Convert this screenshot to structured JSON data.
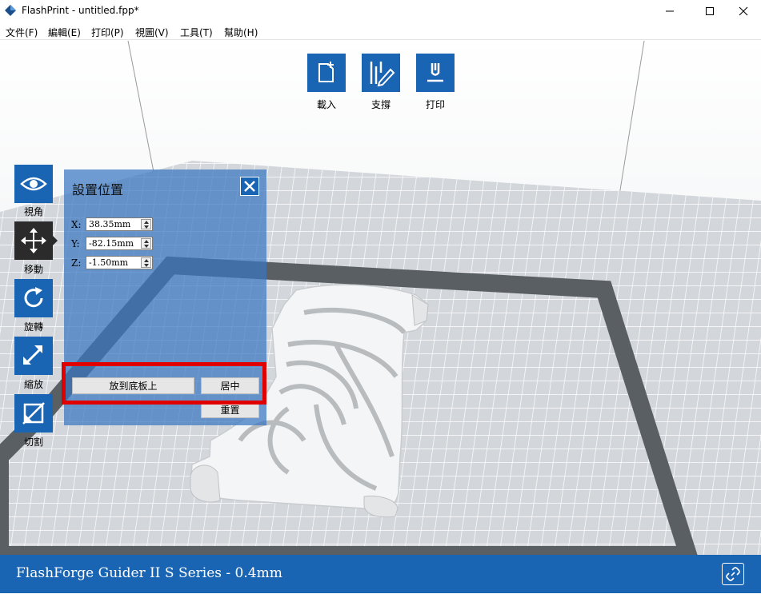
{
  "window": {
    "title": "FlashPrint - untitled.fpp*",
    "logo_icon": "flashprint-logo-icon",
    "controls": [
      "minimize-icon",
      "maximize-icon",
      "close-icon"
    ]
  },
  "menu": {
    "items": [
      "文件(F)",
      "編輯(E)",
      "打印(P)",
      "視圖(V)",
      "工具(T)",
      "幫助(H)"
    ]
  },
  "toolbar": {
    "buttons": [
      {
        "label": "載入",
        "icon": "load-file-icon"
      },
      {
        "label": "支撐",
        "icon": "support-icon"
      },
      {
        "label": "打印",
        "icon": "print-icon"
      }
    ]
  },
  "sidebar": {
    "items": [
      {
        "label": "視角",
        "icon": "eye-icon",
        "active": false
      },
      {
        "label": "移動",
        "icon": "move-icon",
        "active": true
      },
      {
        "label": "旋轉",
        "icon": "rotate-icon",
        "active": false
      },
      {
        "label": "縮放",
        "icon": "scale-icon",
        "active": false
      },
      {
        "label": "切割",
        "icon": "cut-icon",
        "active": false
      }
    ]
  },
  "position_panel": {
    "title": "設置位置",
    "fields": [
      {
        "label": "X:",
        "value": "38.35mm"
      },
      {
        "label": "Y:",
        "value": "-82.15mm"
      },
      {
        "label": "Z:",
        "value": "-1.50mm"
      }
    ],
    "drop_to_bed_label": "放到底板上",
    "center_label": "居中",
    "reset_label": "重置",
    "highlight_color": "#e00000"
  },
  "statusbar": {
    "printer": "FlashForge Guider II S Series - 0.4mm",
    "link_icon": "link-icon"
  },
  "colors": {
    "accent": "#1a64b4",
    "active_tool": "#2b2b2b",
    "panel": "#3876c0"
  }
}
